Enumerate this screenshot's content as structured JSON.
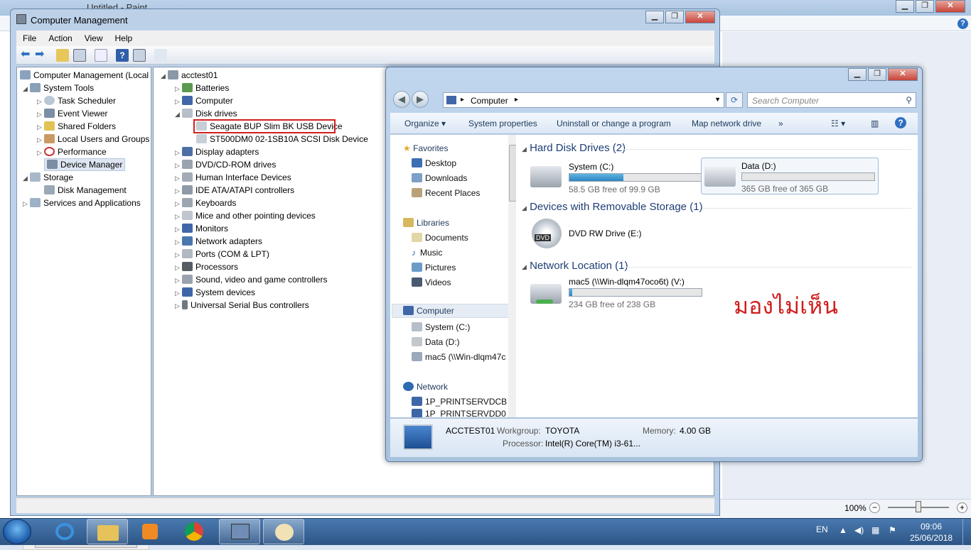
{
  "paint": {
    "title": "Untitled - Paint",
    "zoom": "100%",
    "zoom_minus": "−",
    "zoom_plus": "+",
    "help": "?"
  },
  "cm": {
    "title": "Computer Management",
    "menu": [
      "File",
      "Action",
      "View",
      "Help"
    ],
    "left_tree": {
      "root": "Computer Management (Local",
      "system_tools": "System Tools",
      "task_scheduler": "Task Scheduler",
      "event_viewer": "Event Viewer",
      "shared_folders": "Shared Folders",
      "local_users": "Local Users and Groups",
      "performance": "Performance",
      "device_manager": "Device Manager",
      "storage": "Storage",
      "disk_management": "Disk Management",
      "services": "Services and Applications"
    },
    "devices": {
      "root": "acctest01",
      "categories": [
        "Batteries",
        "Computer",
        "Disk drives",
        "Display adapters",
        "DVD/CD-ROM drives",
        "Human Interface Devices",
        "IDE ATA/ATAPI controllers",
        "Keyboards",
        "Mice and other pointing devices",
        "Monitors",
        "Network adapters",
        "Ports (COM & LPT)",
        "Processors",
        "Sound, video and game controllers",
        "System devices",
        "Universal Serial Bus controllers"
      ],
      "disk1": "Seagate BUP Slim BK USB Device",
      "disk2": "ST500DM0 02-1SB10A SCSI Disk Device"
    }
  },
  "explorer": {
    "address": "Computer",
    "search_placeholder": "Search Computer",
    "cmd": {
      "organize": "Organize",
      "sysprops": "System properties",
      "uninstall": "Uninstall or change a program",
      "mapdrive": "Map network drive",
      "more": "»"
    },
    "nav": {
      "favorites": "Favorites",
      "desktop": "Desktop",
      "downloads": "Downloads",
      "recent": "Recent Places",
      "libraries": "Libraries",
      "documents": "Documents",
      "music": "Music",
      "pictures": "Pictures",
      "videos": "Videos",
      "computer": "Computer",
      "sysc": "System (C:)",
      "datad": "Data (D:)",
      "mac5": "mac5 (\\\\Win-dlqm47c",
      "network": "Network",
      "net1": "1P_PRINTSERVDCB",
      "net2": "1P_PRINTSERVDD0"
    },
    "groups": {
      "hdd": "Hard Disk Drives (2)",
      "removable": "Devices with Removable Storage (1)",
      "network": "Network Location (1)"
    },
    "drives": {
      "c": {
        "name": "System (C:)",
        "free": "58.5 GB free of 99.9 GB",
        "used_fraction": 0.41
      },
      "d": {
        "name": "Data (D:)",
        "free": "365 GB free of 365 GB",
        "used_fraction": 0.0
      },
      "e": {
        "name": "DVD RW Drive (E:)",
        "label": "DVD"
      },
      "v": {
        "name": "mac5 (\\\\Win-dlqm47oco6t) (V:)",
        "free": "234 GB free of 238 GB",
        "used_fraction": 0.02
      }
    },
    "details": {
      "pcname": "ACCTEST01",
      "workgroup_label": "Workgroup:",
      "workgroup": "TOYOTA",
      "memory_label": "Memory:",
      "memory": "4.00 GB",
      "processor_label": "Processor:",
      "processor": "Intel(R) Core(TM) i3-61..."
    }
  },
  "annotation": "มองไม่เห็น",
  "taskbar": {
    "lang": "EN",
    "time": "09:06",
    "date": "25/06/2018"
  },
  "colors": {
    "highlight_box": "#d21f1f",
    "bar_fill": "#2c86c4",
    "annotation": "#d01f1f"
  }
}
